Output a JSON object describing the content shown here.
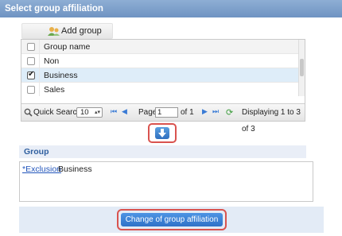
{
  "title": "Select group affiliation",
  "toolbar": {
    "add_label": "Add group"
  },
  "grid": {
    "column_header": "Group name",
    "rows": [
      {
        "name": "Non",
        "checked": false
      },
      {
        "name": "Business",
        "checked": true
      },
      {
        "name": "Sales",
        "checked": false
      }
    ]
  },
  "pager": {
    "quick_search_label": "Quick Search",
    "page_size": "10",
    "page_label": "Page",
    "page_value": "1",
    "of_label": "of 1",
    "display_text": "Displaying 1 to 3 of 3"
  },
  "group_section": {
    "heading": "Group",
    "exclusion_link": "*Exclusion",
    "selected_group": "Business"
  },
  "footer": {
    "change_label": "Change of group affiliation"
  },
  "colors": {
    "title_bg": "#7a9cc8",
    "accent_blue": "#2f72c8",
    "highlight_red": "#d9534f",
    "selected_row": "#deedf9"
  },
  "icons": {
    "add": "add-group-icon",
    "move": "move-down-icon",
    "search": "search-icon",
    "refresh": "refresh-icon"
  }
}
